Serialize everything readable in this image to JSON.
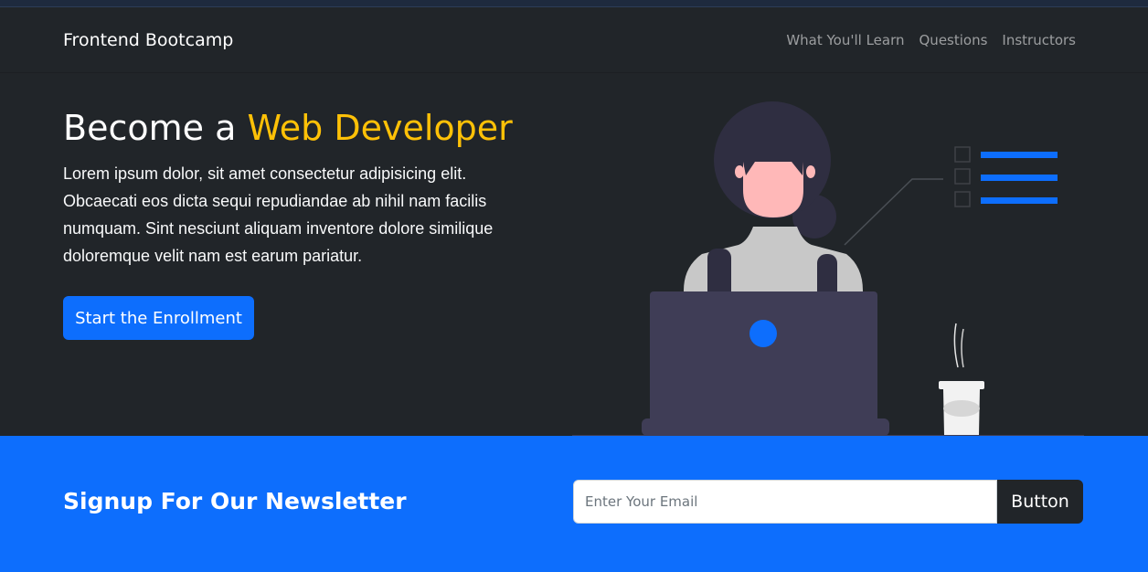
{
  "navbar": {
    "brand": "Frontend Bootcamp",
    "links": [
      "What You'll Learn",
      "Questions",
      "Instructors"
    ]
  },
  "hero": {
    "title_prefix": "Become a ",
    "title_accent": "Web Developer",
    "description": "Lorem ipsum dolor, sit amet consectetur adipisicing elit. Obcaecati eos dicta sequi repudiandae ab nihil nam facilis numquam. Sint nesciunt aliquam inventore dolore similique doloremque velit nam est earum pariatur.",
    "cta_label": "Start the Enrollment"
  },
  "newsletter": {
    "title": "Signup For Our Newsletter",
    "input_placeholder": "Enter Your Email",
    "button_label": "Button"
  },
  "colors": {
    "dark": "#212529",
    "primary": "#0d6efd",
    "accent": "#ffc107"
  },
  "icons": {
    "illustration": "woman-at-laptop-illustration"
  }
}
